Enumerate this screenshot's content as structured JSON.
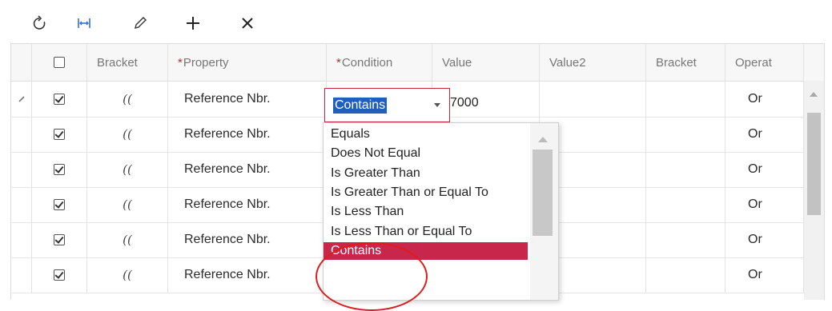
{
  "toolbar": {
    "refresh": "refresh-icon",
    "fit": "fit-columns-icon",
    "edit": "edit-icon",
    "add": "add-icon",
    "delete": "delete-icon"
  },
  "grid": {
    "headers": {
      "bracket": "Bracket",
      "property": "Property",
      "condition": "Condition",
      "value": "Value",
      "value2": "Value2",
      "bracket2": "Bracket",
      "operator": "Operat"
    },
    "required_mark": "*",
    "rows": [
      {
        "bracket": "((",
        "property": "Reference Nbr.",
        "operator": "Or"
      },
      {
        "bracket": "((",
        "property": "Reference Nbr.",
        "operator": "Or"
      },
      {
        "bracket": "((",
        "property": "Reference Nbr.",
        "operator": "Or"
      },
      {
        "bracket": "((",
        "property": "Reference Nbr.",
        "operator": "Or"
      },
      {
        "bracket": "((",
        "property": "Reference Nbr.",
        "operator": "Or"
      },
      {
        "bracket": "((",
        "property": "Reference Nbr.",
        "operator": "Or"
      }
    ],
    "active_row_value": "7000"
  },
  "editor": {
    "selected": "Contains"
  },
  "dropdown": {
    "options": [
      "Equals",
      "Does Not Equal",
      "Is Greater Than",
      "Is Greater Than or Equal To",
      "Is Less Than",
      "Is Less Than or Equal To",
      "Contains"
    ],
    "active_index": 6
  },
  "colors": {
    "accent": "#c8264a",
    "selection": "#1f5fbf",
    "annotation": "#e01b1b"
  }
}
